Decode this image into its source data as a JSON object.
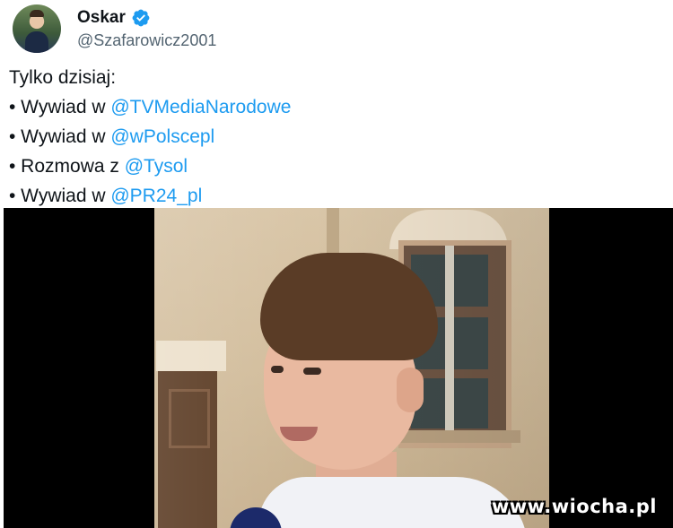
{
  "author": {
    "name": "Oskar",
    "handle": "@Szafarowicz2001",
    "verified": true,
    "verified_color": "#1d9bf0"
  },
  "tweet": {
    "intro": "Tylko dzisiaj:",
    "lines": [
      {
        "prefix": "• Wywiad w ",
        "mention": "@TVMediaNarodowe"
      },
      {
        "prefix": "• Wywiad w ",
        "mention": "@wPolscepl"
      },
      {
        "prefix": "• Rozmowa z ",
        "mention": "@Tysol"
      },
      {
        "prefix": "• Wywiad w ",
        "mention": "@PR24_pl"
      }
    ],
    "mention_color": "#1d9bf0"
  },
  "media": {
    "type": "video-still",
    "watermark": "www.wiocha.pl"
  }
}
